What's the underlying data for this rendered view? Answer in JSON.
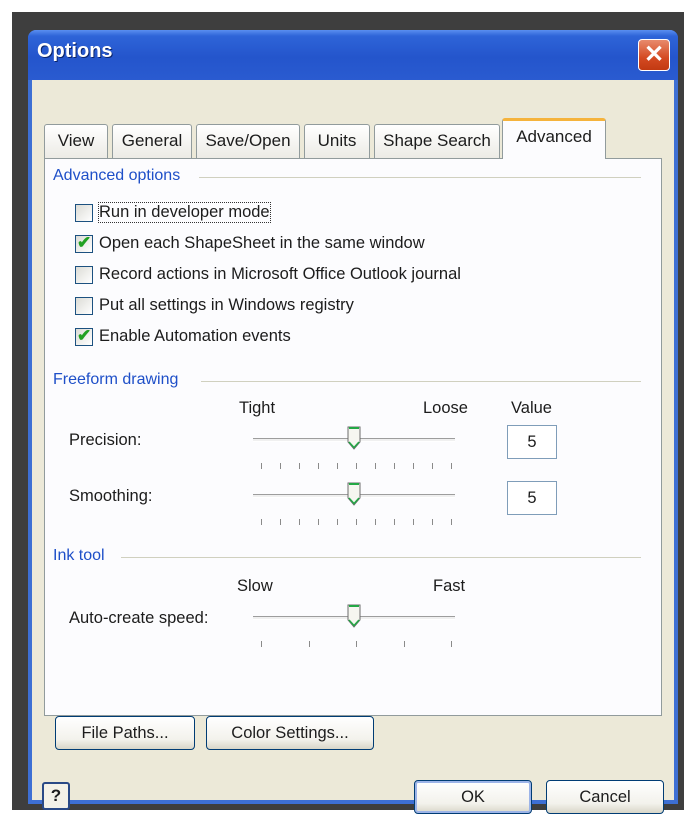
{
  "window": {
    "title": "Options",
    "close_glyph": "✕"
  },
  "tabs": [
    "View",
    "General",
    "Save/Open",
    "Units",
    "Shape Search",
    "Advanced"
  ],
  "active_tab": "Advanced",
  "advanced_options": {
    "label": "Advanced options",
    "items": [
      {
        "text": "Run in developer mode",
        "checked": false
      },
      {
        "text": "Open each ShapeSheet in the same window",
        "checked": true
      },
      {
        "text": "Record actions in Microsoft Office Outlook journal",
        "checked": false
      },
      {
        "text": "Put all settings in Windows registry",
        "checked": false
      },
      {
        "text": "Enable Automation events",
        "checked": true
      }
    ]
  },
  "freeform": {
    "label": "Freeform drawing",
    "tight_label": "Tight",
    "loose_label": "Loose",
    "value_header": "Value",
    "precision": {
      "label": "Precision:",
      "value": "5",
      "position": 0.5
    },
    "smoothing": {
      "label": "Smoothing:",
      "value": "5",
      "position": 0.5
    }
  },
  "ink": {
    "label": "Ink tool",
    "slow_label": "Slow",
    "fast_label": "Fast",
    "speed": {
      "label": "Auto-create speed:",
      "position": 0.5
    }
  },
  "buttons": {
    "file_paths": "File Paths...",
    "color_settings": "Color Settings...",
    "ok": "OK",
    "cancel": "Cancel",
    "help_glyph": "?"
  },
  "check_glyph": "✔"
}
